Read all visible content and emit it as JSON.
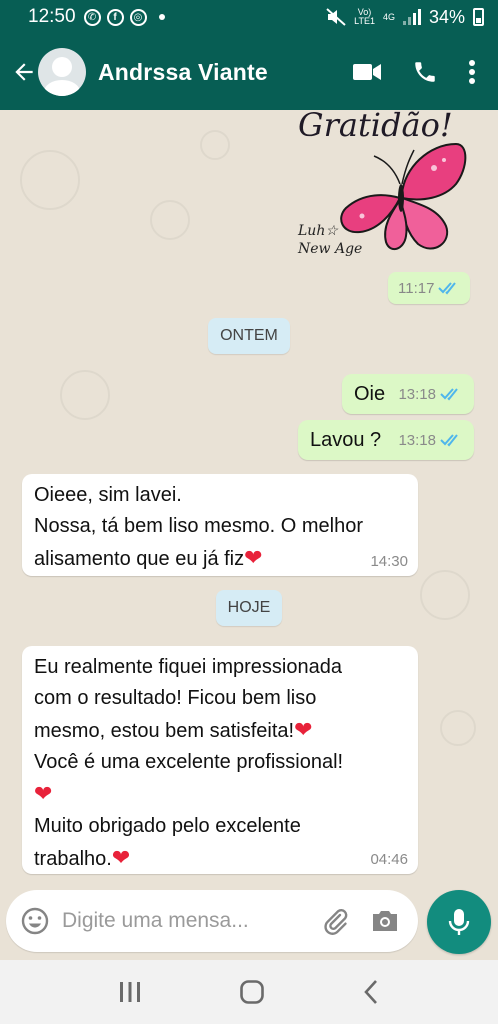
{
  "status_bar": {
    "time": "12:50",
    "network_top": "Vo)",
    "network_lte": "LTE1",
    "network_gen": "4G",
    "battery": "34%"
  },
  "header": {
    "contact_name": "Andrssa Viante"
  },
  "sticker": {
    "title": "Gratidão!",
    "signature_line1": "Luh☆",
    "signature_line2": "New Age",
    "time": "11:17"
  },
  "day_separators": {
    "yesterday": "ONTEM",
    "today": "HOJE"
  },
  "messages": [
    {
      "direction": "out",
      "text": "Oie",
      "time": "13:18",
      "status": "read"
    },
    {
      "direction": "out",
      "text": "Lavou ?",
      "time": "13:18",
      "status": "read"
    },
    {
      "direction": "in",
      "text_line1": "Oieee, sim lavei.",
      "text_line2": "Nossa, tá  bem liso mesmo. O melhor",
      "text_line3": "alisamento que eu já fiz",
      "emoji": "❤",
      "time": "14:30"
    },
    {
      "direction": "in",
      "text_line1": "Eu realmente fiquei impressionada",
      "text_line2": "com o resultado! Ficou bem liso",
      "text_line3": "mesmo, estou bem satisfeita!",
      "text_line4": "Você é uma excelente profissional!",
      "text_line6": "Muito obrigado pelo excelente",
      "text_line7": "trabalho.",
      "emoji": "❤",
      "time": "04:46"
    }
  ],
  "input": {
    "placeholder": "Digite uma mensa..."
  },
  "colors": {
    "header": "#075e54",
    "outgoing_bubble": "#dcf8c6",
    "incoming_bubble": "#ffffff",
    "read_ticks": "#4fb6ec",
    "mic_button": "#128c7e",
    "heart": "#e8223a"
  }
}
